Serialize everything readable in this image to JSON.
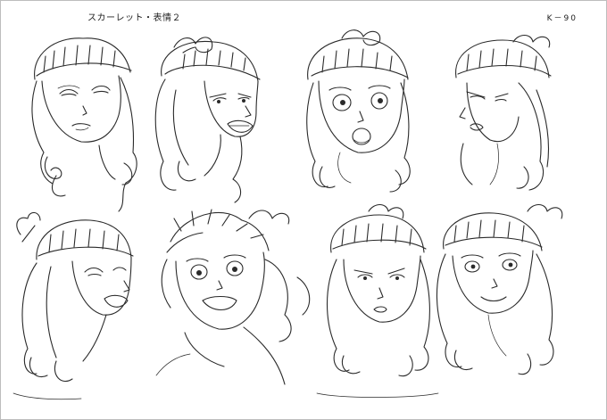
{
  "sheet": {
    "title": "スカーレット・表情２",
    "code": "K－90"
  },
  "drawings": [
    {
      "name": "head-smug"
    },
    {
      "name": "head-angry-shout"
    },
    {
      "name": "head-surprised"
    },
    {
      "name": "head-pout"
    },
    {
      "name": "head-laugh"
    },
    {
      "name": "head-excited-tousled"
    },
    {
      "name": "head-frown"
    },
    {
      "name": "head-smile"
    }
  ]
}
